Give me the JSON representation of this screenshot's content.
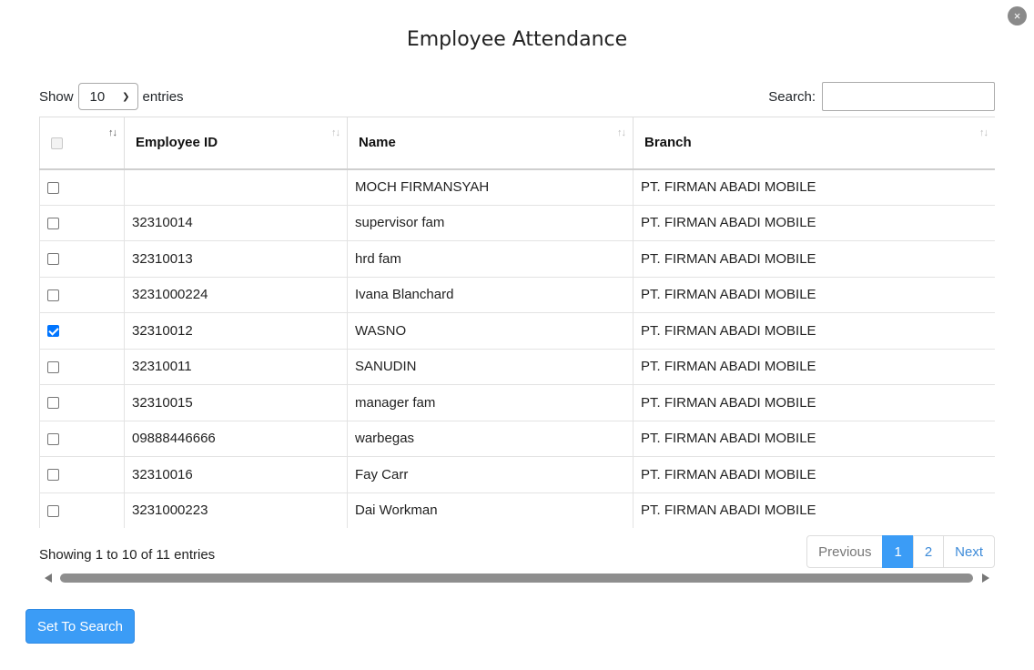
{
  "dialog": {
    "title": "Employee Attendance",
    "close_symbol": "×",
    "length": {
      "prefix": "Show",
      "value": "10",
      "suffix": "entries"
    },
    "search": {
      "label": "Search:",
      "value": ""
    },
    "table": {
      "columns": [
        "",
        "Employee ID",
        "Name",
        "Branch"
      ],
      "rows": [
        {
          "checked": false,
          "id": "",
          "name": "MOCH FIRMANSYAH",
          "branch": "PT. FIRMAN ABADI MOBILE"
        },
        {
          "checked": false,
          "id": "32310014",
          "name": "supervisor fam",
          "branch": "PT. FIRMAN ABADI MOBILE"
        },
        {
          "checked": false,
          "id": "32310013",
          "name": "hrd fam",
          "branch": "PT. FIRMAN ABADI MOBILE"
        },
        {
          "checked": false,
          "id": "3231000224",
          "name": "Ivana Blanchard",
          "branch": "PT. FIRMAN ABADI MOBILE"
        },
        {
          "checked": true,
          "id": "32310012",
          "name": "WASNO",
          "branch": "PT. FIRMAN ABADI MOBILE"
        },
        {
          "checked": false,
          "id": "32310011",
          "name": "SANUDIN",
          "branch": "PT. FIRMAN ABADI MOBILE"
        },
        {
          "checked": false,
          "id": "32310015",
          "name": "manager fam",
          "branch": "PT. FIRMAN ABADI MOBILE"
        },
        {
          "checked": false,
          "id": "09888446666",
          "name": "warbegas",
          "branch": "PT. FIRMAN ABADI MOBILE"
        },
        {
          "checked": false,
          "id": "32310016",
          "name": "Fay Carr",
          "branch": "PT. FIRMAN ABADI MOBILE"
        },
        {
          "checked": false,
          "id": "3231000223",
          "name": "Dai Workman",
          "branch": "PT. FIRMAN ABADI MOBILE"
        }
      ]
    },
    "info": "Showing 1 to 10 of 11 entries",
    "pagination": {
      "previous": "Previous",
      "pages": [
        "1",
        "2"
      ],
      "current": "1",
      "next": "Next"
    },
    "submit_label": "Set To Search"
  },
  "colors": {
    "primary": "#3b9cf6",
    "checkbox_checked": "#0075ff",
    "close_button": "#8a8a8a"
  }
}
